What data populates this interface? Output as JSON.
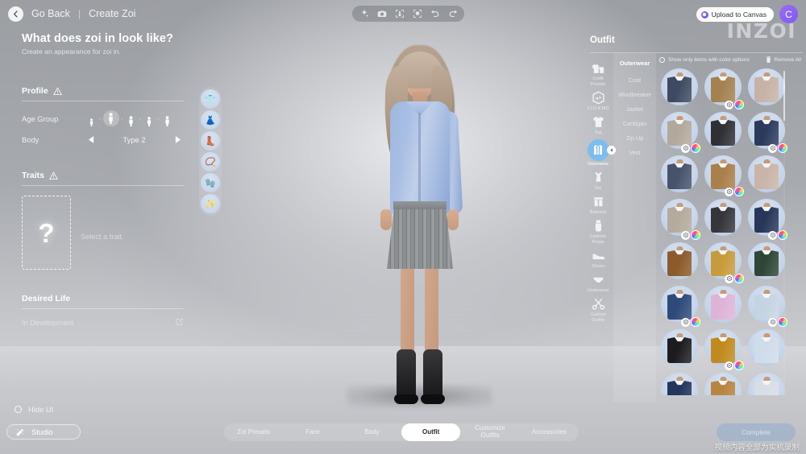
{
  "topbar": {
    "back_label": "Go Back",
    "separator": "|",
    "title": "Create Zoi",
    "tools": [
      {
        "name": "sparkle-icon",
        "label": "Sparkle"
      },
      {
        "name": "camera-icon",
        "label": "Camera"
      },
      {
        "name": "frame-body-icon",
        "label": "Frame Body"
      },
      {
        "name": "frame-face-icon",
        "label": "Frame Face"
      },
      {
        "name": "undo-icon",
        "label": "Undo"
      },
      {
        "name": "redo-icon",
        "label": "Redo"
      }
    ],
    "upload_label": "Upload to Canvas",
    "profile_initial": "C",
    "brand": "INZOI"
  },
  "left": {
    "headline": "What does zoi in look like?",
    "subline": "Create an appearance for zoi in.",
    "profile": {
      "section_label": "Profile",
      "age_group_label": "Age Group",
      "age_options": [
        "Infant",
        "Child",
        "Teen",
        "Adult",
        "Elder"
      ],
      "age_selected_index": 1,
      "body_label": "Body",
      "body_value": "Type 2"
    },
    "traits": {
      "section_label": "Traits",
      "placeholder_glyph": "?",
      "hint": "Select a trait."
    },
    "desired_life": {
      "section_label": "Desired Life",
      "status": "In Development"
    }
  },
  "worn_items": [
    {
      "name": "worn-top",
      "glyph": "👕"
    },
    {
      "name": "worn-bottom",
      "glyph": "👗"
    },
    {
      "name": "worn-shoes",
      "glyph": "👢"
    },
    {
      "name": "worn-necklace",
      "glyph": "📿"
    },
    {
      "name": "worn-gloves",
      "glyph": "🧤"
    },
    {
      "name": "worn-earrings",
      "glyph": "✨"
    }
  ],
  "right": {
    "panel_title": "Outfit",
    "filter_label": "Show only items with color options",
    "remove_all_label": "Remove All",
    "categories": [
      {
        "label": "Outfit\nPresets",
        "icon": "outfit-presets-icon",
        "active": false
      },
      {
        "label": "CLO & MD",
        "icon": "clo-md-icon",
        "active": false
      },
      {
        "label": "Top",
        "icon": "top-icon",
        "active": false
      },
      {
        "label": "Outerwear",
        "icon": "outerwear-icon",
        "active": true
      },
      {
        "label": "Set",
        "icon": "set-icon",
        "active": false
      },
      {
        "label": "Bottoms",
        "icon": "bottoms-icon",
        "active": false
      },
      {
        "label": "Fashion\nProps",
        "icon": "fashion-props-icon",
        "active": false
      },
      {
        "label": "Shoes",
        "icon": "shoes-icon",
        "active": false
      },
      {
        "label": "Underwear",
        "icon": "underwear-icon",
        "active": false
      },
      {
        "label": "Custom\nOutfits",
        "icon": "custom-outfits-icon",
        "active": false
      }
    ],
    "subcategory_header": "Outerwear",
    "subcategories": [
      {
        "label": "Coat",
        "active": false
      },
      {
        "label": "Windbreaker",
        "active": false
      },
      {
        "label": "Jacket",
        "active": false
      },
      {
        "label": "Cardigan",
        "active": false
      },
      {
        "label": "Zip-Up",
        "active": false
      },
      {
        "label": "Vest",
        "active": false
      }
    ],
    "items": [
      {
        "name": "outerwear-item-1",
        "color": "#3d4a61",
        "has_material": false,
        "has_color": false
      },
      {
        "name": "outerwear-item-2",
        "color": "#a4814f",
        "has_material": true,
        "has_color": true
      },
      {
        "name": "outerwear-item-3",
        "color": "#c7b2a6",
        "has_material": false,
        "has_color": false
      },
      {
        "name": "outerwear-item-4",
        "color": "#b2a99c",
        "has_material": true,
        "has_color": true
      },
      {
        "name": "outerwear-item-5",
        "color": "#2e3034",
        "has_material": false,
        "has_color": false
      },
      {
        "name": "outerwear-item-6",
        "color": "#2b3a5c",
        "has_material": true,
        "has_color": true
      },
      {
        "name": "outerwear-item-7",
        "color": "#47536b",
        "has_material": false,
        "has_color": false
      },
      {
        "name": "outerwear-item-8",
        "color": "#a97f4a",
        "has_material": true,
        "has_color": true
      },
      {
        "name": "outerwear-item-9",
        "color": "#c9b4a8",
        "has_material": false,
        "has_color": false
      },
      {
        "name": "outerwear-item-10",
        "color": "#b4aa9d",
        "has_material": true,
        "has_color": true
      },
      {
        "name": "outerwear-item-11",
        "color": "#34363a",
        "has_material": false,
        "has_color": false
      },
      {
        "name": "outerwear-item-12",
        "color": "#27365a",
        "has_material": true,
        "has_color": true
      },
      {
        "name": "outerwear-item-13",
        "color": "#8c5a2b",
        "has_material": false,
        "has_color": false
      },
      {
        "name": "outerwear-item-14",
        "color": "#c79b3d",
        "has_material": true,
        "has_color": true
      },
      {
        "name": "outerwear-item-15",
        "color": "#2f4536",
        "has_material": false,
        "has_color": false
      },
      {
        "name": "outerwear-item-16",
        "color": "#2f4a7a",
        "has_material": true,
        "has_color": true
      },
      {
        "name": "outerwear-item-17",
        "color": "#ddb4d8",
        "has_material": false,
        "has_color": false
      },
      {
        "name": "outerwear-item-18",
        "color": "#c5d4e3",
        "has_material": true,
        "has_color": true
      },
      {
        "name": "outerwear-item-19",
        "color": "#1c1c1f",
        "has_material": false,
        "has_color": false
      },
      {
        "name": "outerwear-item-20",
        "color": "#c08a1e",
        "has_material": true,
        "has_color": true
      },
      {
        "name": "outerwear-item-21",
        "color": "#cfdcea",
        "has_material": false,
        "has_color": false
      },
      {
        "name": "outerwear-item-22",
        "color": "#24355c",
        "has_material": false,
        "has_color": false
      },
      {
        "name": "outerwear-item-23",
        "color": "#b8853f",
        "has_material": false,
        "has_color": false
      },
      {
        "name": "outerwear-item-24",
        "color": "#d8dee6",
        "has_material": false,
        "has_color": false
      }
    ]
  },
  "bottom": {
    "hide_ui_label": "Hide UI",
    "studio_label": "Studio",
    "tabs": [
      {
        "label": "Zoi Presets",
        "active": false
      },
      {
        "label": "Face",
        "active": false
      },
      {
        "label": "Body",
        "active": false
      },
      {
        "label": "Outfit",
        "active": true
      },
      {
        "label": "Customize\nOutfits",
        "active": false
      },
      {
        "label": "Accessories",
        "active": false
      }
    ],
    "complete_label": "Complete",
    "watermark": "视频内容全部为实机录制"
  },
  "colors": {
    "accent_blue": "#7cbdf0",
    "panel_white": "#ffffff",
    "brand_purple": "#7c5cf5"
  }
}
